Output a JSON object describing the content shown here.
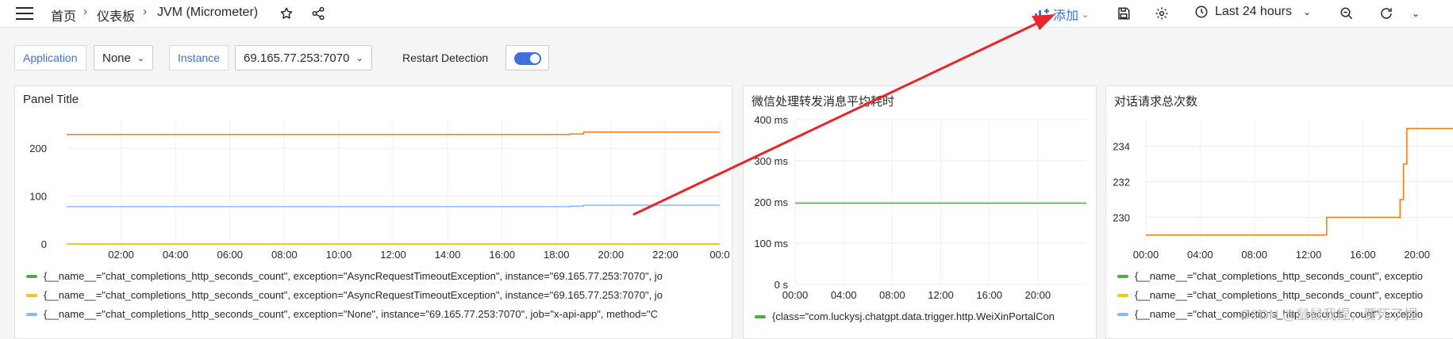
{
  "breadcrumb": {
    "home": "首页",
    "dashboards": "仪表板",
    "current": "JVM (Micrometer)"
  },
  "toolbar": {
    "add_label": "添加",
    "time_range": "Last 24 hours"
  },
  "variables": {
    "application_label": "Application",
    "application_value": "None",
    "instance_label": "Instance",
    "instance_value": "69.165.77.253:7070",
    "restart_label": "Restart Detection"
  },
  "colors": {
    "accent": "#3d71d9",
    "orange": "#ff780a",
    "blue": "#8ab8ff",
    "green": "#56a64b",
    "yellow": "#f2cc0c",
    "annotation_arrow": "#e8262a"
  },
  "panels": [
    {
      "title": "Panel Title",
      "chart_data": {
        "type": "line",
        "x": [
          "00:00",
          "01:00",
          "02:00",
          "03:00",
          "04:00",
          "05:00",
          "06:00",
          "07:00",
          "08:00",
          "09:00",
          "10:00",
          "11:00",
          "12:00",
          "13:00",
          "14:00",
          "15:00",
          "16:00",
          "17:00",
          "18:00",
          "18:30",
          "19:00",
          "19:30",
          "20:00",
          "21:00",
          "22:00",
          "23:00",
          "24:00"
        ],
        "xticks": [
          "02:00",
          "04:00",
          "06:00",
          "08:00",
          "10:00",
          "12:00",
          "14:00",
          "16:00",
          "18:00",
          "20:00",
          "22:00",
          "00:0"
        ],
        "yticks": [
          "0",
          "100",
          "200"
        ],
        "ylim": [
          0,
          260
        ],
        "series": [
          {
            "color": "#56a64b",
            "values": [
              0,
              0,
              0,
              0,
              0,
              0,
              0,
              0,
              0,
              0,
              0,
              0,
              0,
              0,
              0,
              0,
              0,
              0,
              0,
              0,
              0,
              0,
              0,
              0,
              0,
              0,
              0
            ]
          },
          {
            "color": "#f2cc0c",
            "values": [
              0,
              0,
              0,
              0,
              0,
              0,
              0,
              0,
              0,
              0,
              0,
              0,
              0,
              0,
              0,
              0,
              0,
              0,
              0,
              0,
              0,
              0,
              0,
              0,
              0,
              0,
              0
            ]
          },
          {
            "color": "#8ab8ff",
            "values": [
              78,
              78,
              78,
              78,
              78,
              78,
              78,
              78,
              78,
              78,
              78,
              78,
              78,
              78,
              78,
              78,
              78,
              78,
              78,
              79,
              81,
              81,
              81,
              81,
              81,
              81,
              81
            ]
          },
          {
            "color": "#ff780a",
            "values": [
              229,
              229,
              229,
              229,
              229,
              229,
              229,
              229,
              229,
              229,
              229,
              229,
              229,
              229,
              229,
              229,
              229,
              229,
              229,
              230,
              234,
              234,
              234,
              234,
              234,
              234,
              234
            ]
          }
        ]
      },
      "legend": [
        {
          "color": "#56a64b",
          "text": "{__name__=\"chat_completions_http_seconds_count\", exception=\"AsyncRequestTimeoutException\", instance=\"69.165.77.253:7070\", jo"
        },
        {
          "color": "#f2cc0c",
          "text": "{__name__=\"chat_completions_http_seconds_count\", exception=\"AsyncRequestTimeoutException\", instance=\"69.165.77.253:7070\", jo"
        },
        {
          "color": "#8ab8ff",
          "text": "{__name__=\"chat_completions_http_seconds_count\", exception=\"None\", instance=\"69.165.77.253:7070\", job=\"x-api-app\", method=\"C"
        }
      ]
    },
    {
      "title": "微信处理转发消息平均耗时",
      "chart_data": {
        "type": "line",
        "x": [
          "00:00",
          "04:00",
          "08:00",
          "12:00",
          "16:00",
          "20:00",
          "24:00"
        ],
        "xticks": [
          "00:00",
          "04:00",
          "08:00",
          "12:00",
          "16:00",
          "20:00"
        ],
        "yticks": [
          "0 s",
          "100 ms",
          "200 ms",
          "300 ms",
          "400 ms"
        ],
        "ylim": [
          0,
          400
        ],
        "series": [
          {
            "color": "#56a64b",
            "values": [
              197,
              197,
              197,
              197,
              197,
              197,
              197
            ]
          }
        ]
      },
      "legend": [
        {
          "color": "#56a64b",
          "text": "{class=\"com.luckysj.chatgpt.data.trigger.http.WeiXinPortalCon"
        }
      ]
    },
    {
      "title": "对话请求总次数",
      "chart_data": {
        "type": "line",
        "x": [
          "00:00",
          "04:00",
          "08:00",
          "12:00",
          "13:10",
          "13:20",
          "17:00",
          "18:30",
          "18:45",
          "19:00",
          "19:15",
          "19:30",
          "20:00",
          "24:00"
        ],
        "xticks": [
          "00:00",
          "04:00",
          "08:00",
          "12:00",
          "16:00",
          "20:00"
        ],
        "yticks": [
          "230",
          "232",
          "234"
        ],
        "ylim": [
          228.5,
          235.5
        ],
        "series": [
          {
            "color": "#ff780a",
            "values": [
              229,
              229,
              229,
              229,
              229,
              230,
              230,
              230,
              231,
              233,
              235,
              235,
              235,
              235
            ]
          }
        ]
      },
      "legend": [
        {
          "color": "#56a64b",
          "text": "{__name__=\"chat_completions_http_seconds_count\", exceptio"
        },
        {
          "color": "#f2cc0c",
          "text": "{__name__=\"chat_completions_http_seconds_count\", exceptio"
        },
        {
          "color": "#8ab8ff",
          "text": "{__name__=\"chat_completions_http_seconds_count\", exceptio"
        }
      ]
    }
  ],
  "watermark": "CSDN @鼠鼠我捏，要死了捏"
}
